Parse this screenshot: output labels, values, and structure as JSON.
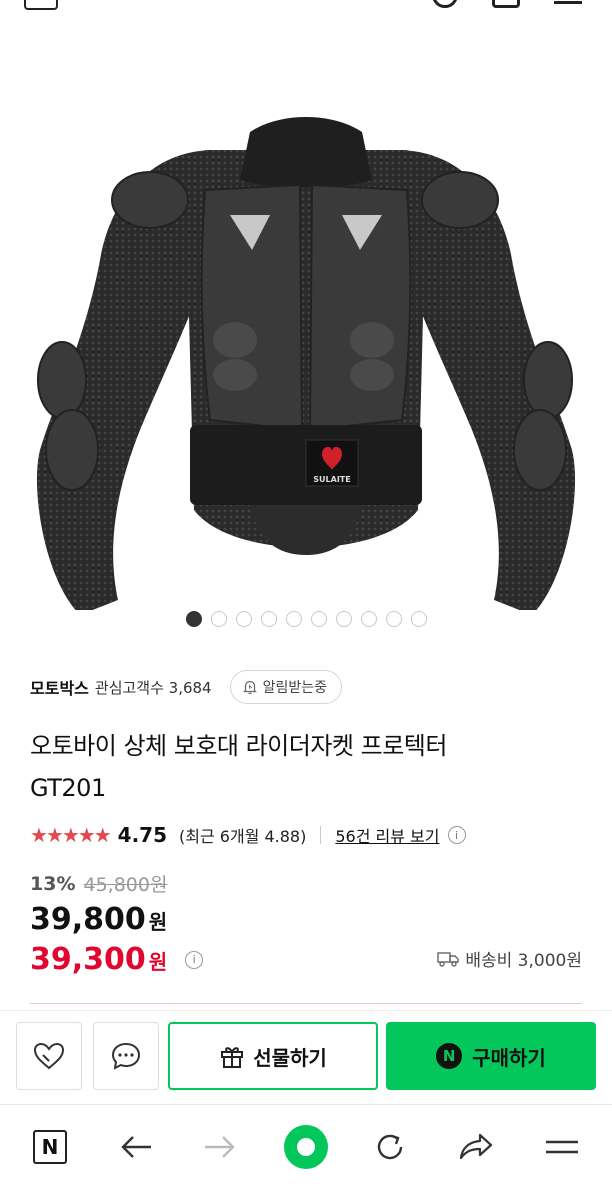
{
  "store": {
    "name": "모토박스",
    "watchers_label": "관심고객수 3,684",
    "alarm_label": "알림받는중"
  },
  "product": {
    "title_line1": "오토바이 상체 보호대 라이더자켓 프로텍터",
    "title_line2": "GT201",
    "image_brand_text": "SULAITE"
  },
  "gallery": {
    "total": 10,
    "current": 1
  },
  "rating": {
    "stars": "★★★★★",
    "score": "4.75",
    "recent": "(최근 6개월 4.88)",
    "review_link": "56건 리뷰 보기"
  },
  "price": {
    "discount_rate": "13%",
    "original": "45,800원",
    "sale": "39,800",
    "benefit": "39,300",
    "currency": "원",
    "shipping": "배송비 3,000원"
  },
  "actions": {
    "gift_label": "선물하기",
    "buy_label": "구매하기",
    "n_badge": "N"
  },
  "browser": {
    "home_label": "N"
  },
  "colors": {
    "naver_green": "#03c75a",
    "price_red": "#e0062f",
    "star_red": "#e4474f"
  }
}
